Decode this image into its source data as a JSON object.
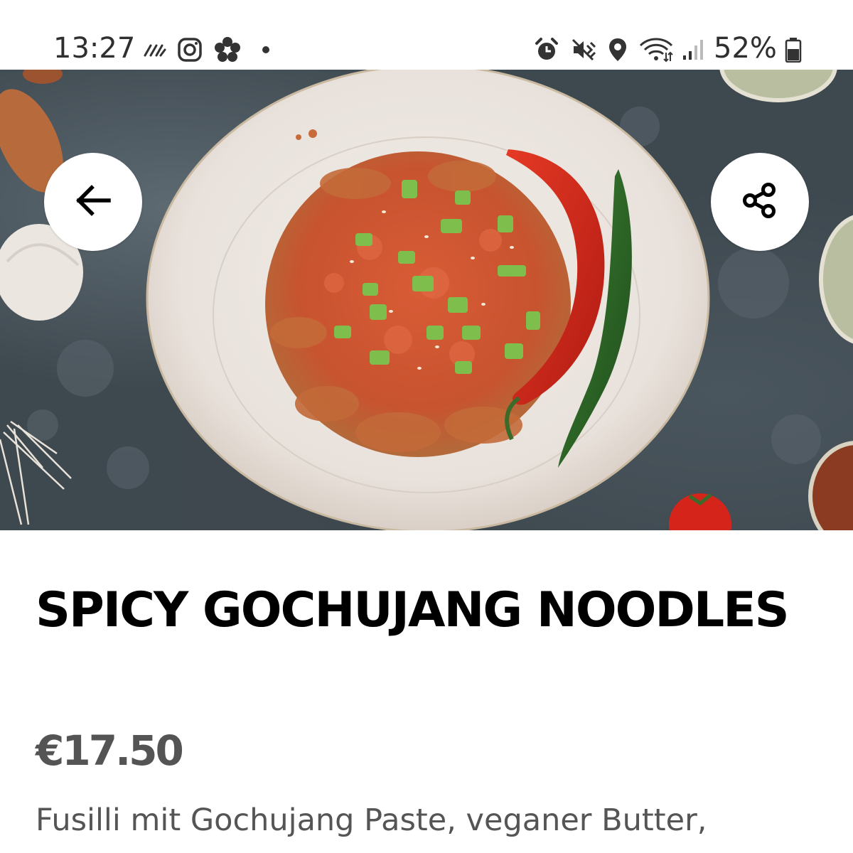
{
  "status_bar": {
    "time": "13:27",
    "battery_percent": "52%",
    "left_icons": [
      "news-feed-icon",
      "instagram-icon",
      "flower-app-icon",
      "notification-dot-icon"
    ],
    "right_icons": [
      "alarm-icon",
      "mute-vibrate-icon",
      "location-icon",
      "wifi-icon",
      "signal-icon",
      "battery-icon"
    ]
  },
  "header": {
    "back_icon": "arrow-left-icon",
    "share_icon": "share-icon"
  },
  "item": {
    "title": "SPICY GOCHUJANG NOODLES",
    "price": "€17.50",
    "description": "Fusilli mit Gochujang Paste, veganer Butter,"
  },
  "colors": {
    "price": "#545454",
    "description": "#555555",
    "chili_red": "#d42a1f",
    "chili_green": "#2f6b2a"
  }
}
